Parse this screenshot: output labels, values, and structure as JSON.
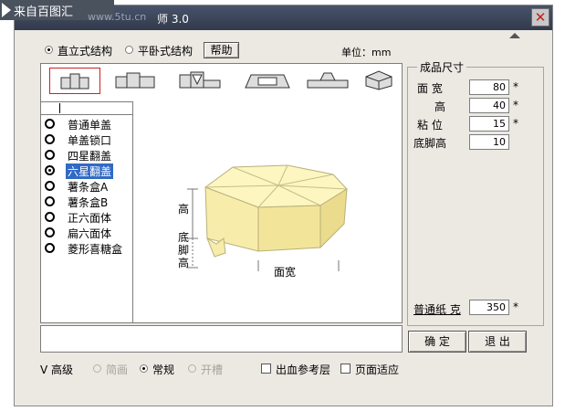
{
  "watermark": {
    "text": "来自百图汇",
    "url": "www.5tu.cn"
  },
  "title": "师 3.0",
  "top": {
    "opt_vertical": "直立式结构",
    "opt_flat": "平卧式结构",
    "help": "帮助",
    "unit": "单位：mm"
  },
  "list": [
    "普通单盖",
    "单盖锁口",
    "四星翻盖",
    "六星翻盖",
    "薯条盒A",
    "薯条盒B",
    "正六面体",
    "扁六面体",
    "菱形喜糖盒"
  ],
  "selected_index": 3,
  "diagram": {
    "height": "高",
    "base": "底脚高",
    "width": "面宽"
  },
  "dims": {
    "legend": "成品尺寸",
    "width_label": "面 宽",
    "width_value": "80",
    "height_label": "高",
    "height_value": "40",
    "glue_label": "粘 位",
    "glue_value": "15",
    "base_label": "底脚高",
    "base_value": "10",
    "star": "*"
  },
  "paper": {
    "label": "普通纸 克",
    "value": "350",
    "star": "*"
  },
  "buttons": {
    "ok": "确 定",
    "cancel": "退 出"
  },
  "bottom": {
    "v_label": "V 高级",
    "opt_simple": "简画",
    "opt_normal": "常规",
    "opt_open": "开槽",
    "chk_bleed": "出血参考层",
    "chk_fit": "页面适应"
  },
  "colors": {
    "title_bar": "#3a4256",
    "selection": "#316ac5",
    "box_fill": "#fbf5b4"
  }
}
